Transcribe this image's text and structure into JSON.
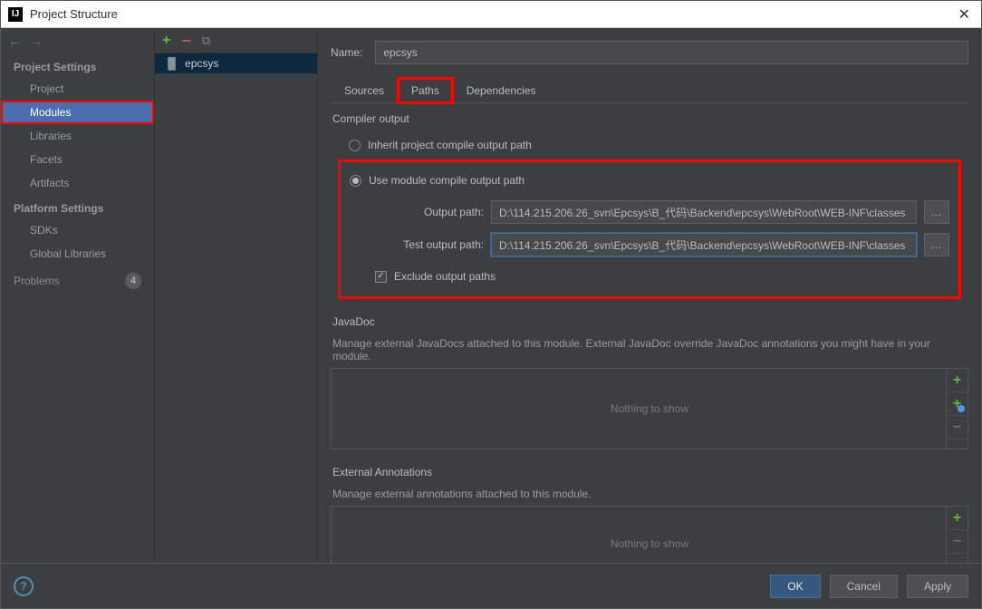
{
  "window": {
    "title": "Project Structure"
  },
  "left": {
    "project_settings_header": "Project Settings",
    "items_project": "Project",
    "items_modules": "Modules",
    "items_libraries": "Libraries",
    "items_facets": "Facets",
    "items_artifacts": "Artifacts",
    "platform_settings_header": "Platform Settings",
    "items_sdks": "SDKs",
    "items_global_libs": "Global Libraries",
    "problems_label": "Problems",
    "problems_count": "4"
  },
  "middle": {
    "module_name": "epcsys"
  },
  "right": {
    "name_label": "Name:",
    "name_value": "epcsys",
    "tab_sources": "Sources",
    "tab_paths": "Paths",
    "tab_deps": "Dependencies",
    "compiler_output_label": "Compiler output",
    "inherit_label": "Inherit project compile output path",
    "use_module_label": "Use module compile output path",
    "output_path_label": "Output path:",
    "output_path_value": "D:\\114.215.206.26_svn\\Epcsys\\B_代码\\Backend\\epcsys\\WebRoot\\WEB-INF\\classes",
    "test_output_path_label": "Test output path:",
    "test_output_path_value": "D:\\114.215.206.26_svn\\Epcsys\\B_代码\\Backend\\epcsys\\WebRoot\\WEB-INF\\classes",
    "exclude_label": "Exclude output paths",
    "javadoc_label": "JavaDoc",
    "javadoc_desc": "Manage external JavaDocs attached to this module. External JavaDoc override JavaDoc annotations you might have in your module.",
    "annot_label": "External Annotations",
    "annot_desc": "Manage external annotations attached to this module.",
    "nothing_to_show": "Nothing to show"
  },
  "footer": {
    "ok": "OK",
    "cancel": "Cancel",
    "apply": "Apply"
  }
}
